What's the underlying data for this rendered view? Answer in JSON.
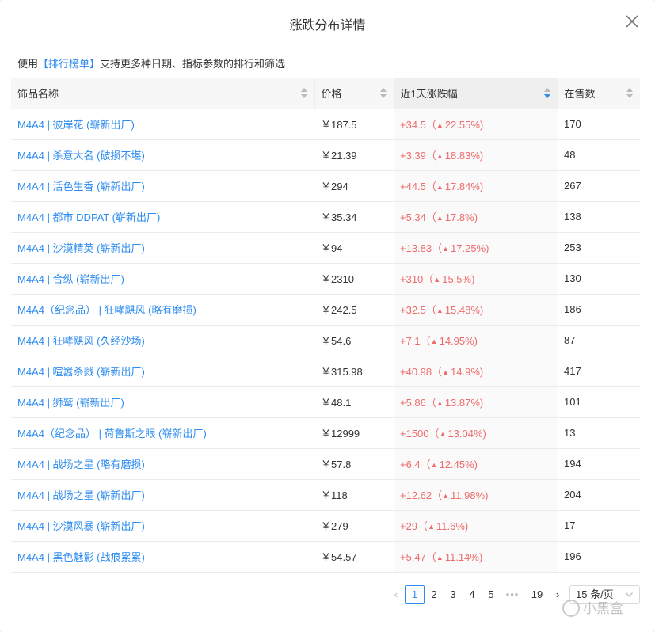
{
  "dialog": {
    "title": "涨跌分布详情",
    "close_icon": "close-icon"
  },
  "hint": {
    "prefix": "使用",
    "link": "【排行榜单】",
    "suffix": "支持更多种日期、指标参数的排行和筛选"
  },
  "colors": {
    "link": "#2d8cf0",
    "rise": "#ee6b6b"
  },
  "table": {
    "headers": [
      "饰品名称",
      "价格",
      "近1天涨跌幅",
      "在售数"
    ],
    "sorted_column": "近1天涨跌幅",
    "rows": [
      {
        "name": "M4A4 | 彼岸花 (崭新出厂)",
        "price": "￥187.5",
        "change": "+34.5（",
        "pct": "22.55%)",
        "count": "170"
      },
      {
        "name": "M4A4 | 杀意大名 (破损不堪)",
        "price": "￥21.39",
        "change": "+3.39（",
        "pct": "18.83%)",
        "count": "48"
      },
      {
        "name": "M4A4 | 活色生香 (崭新出厂)",
        "price": "￥294",
        "change": "+44.5（",
        "pct": "17.84%)",
        "count": "267"
      },
      {
        "name": "M4A4 | 都市 DDPAT (崭新出厂)",
        "price": "￥35.34",
        "change": "+5.34（",
        "pct": "17.8%)",
        "count": "138"
      },
      {
        "name": "M4A4 | 沙漠精英 (崭新出厂)",
        "price": "￥94",
        "change": "+13.83（",
        "pct": "17.25%)",
        "count": "253"
      },
      {
        "name": "M4A4 | 合纵 (崭新出厂)",
        "price": "￥2310",
        "change": "+310（",
        "pct": "15.5%)",
        "count": "130"
      },
      {
        "name": "M4A4（纪念品） | 狂哮飓风 (略有磨损)",
        "price": "￥242.5",
        "change": "+32.5（",
        "pct": "15.48%)",
        "count": "186"
      },
      {
        "name": "M4A4 | 狂哮飓风 (久经沙场)",
        "price": "￥54.6",
        "change": "+7.1（",
        "pct": "14.95%)",
        "count": "87"
      },
      {
        "name": "M4A4 | 喧嚣杀戮 (崭新出厂)",
        "price": "￥315.98",
        "change": "+40.98（",
        "pct": "14.9%)",
        "count": "417"
      },
      {
        "name": "M4A4 | 狮鹫 (崭新出厂)",
        "price": "￥48.1",
        "change": "+5.86（",
        "pct": "13.87%)",
        "count": "101"
      },
      {
        "name": "M4A4（纪念品） | 荷鲁斯之眼 (崭新出厂)",
        "price": "￥12999",
        "change": "+1500（",
        "pct": "13.04%)",
        "count": "13"
      },
      {
        "name": "M4A4 | 战场之星 (略有磨损)",
        "price": "￥57.8",
        "change": "+6.4（",
        "pct": "12.45%)",
        "count": "194"
      },
      {
        "name": "M4A4 | 战场之星 (崭新出厂)",
        "price": "￥118",
        "change": "+12.62（",
        "pct": "11.98%)",
        "count": "204"
      },
      {
        "name": "M4A4 | 沙漠风暴 (崭新出厂)",
        "price": "￥279",
        "change": "+29（",
        "pct": "11.6%)",
        "count": "17"
      },
      {
        "name": "M4A4 | 黑色魅影 (战痕累累)",
        "price": "￥54.57",
        "change": "+5.47（",
        "pct": "11.14%)",
        "count": "196"
      }
    ]
  },
  "pagination": {
    "prev": "‹",
    "pages": [
      "1",
      "2",
      "3",
      "4",
      "5"
    ],
    "active": "1",
    "ellipsis": "•••",
    "last": "19",
    "next": "›",
    "page_size": "15 条/页"
  },
  "watermark": {
    "text": "小黑盒"
  }
}
